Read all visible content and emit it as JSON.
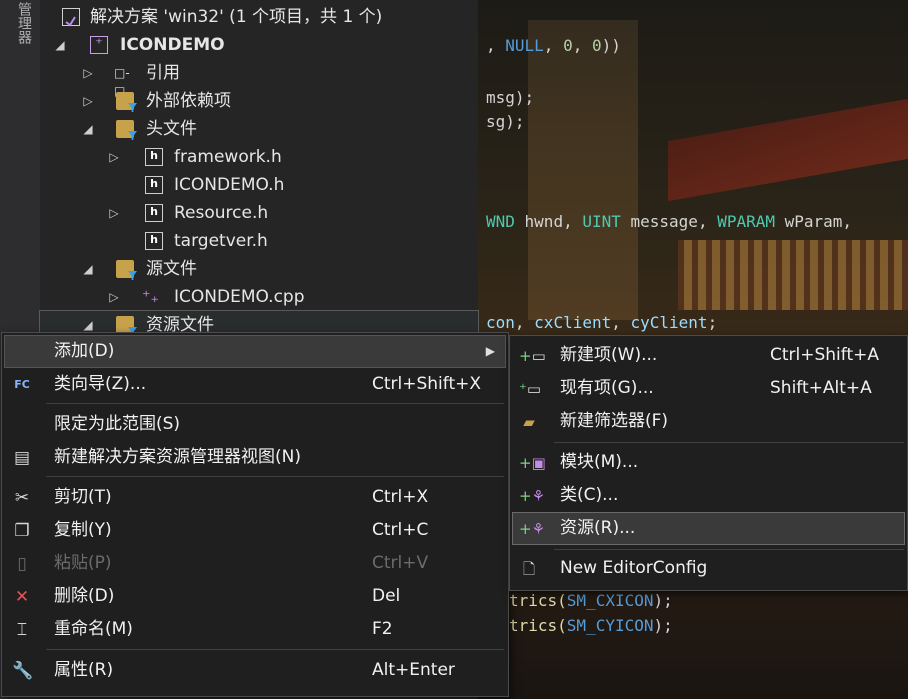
{
  "side_panel_label": "管理器",
  "tree": {
    "solution": "解决方案 'win32' (1 个项目，共 1 个)",
    "project": "ICONDEMO",
    "items": [
      {
        "label": "引用"
      },
      {
        "label": "外部依赖项"
      },
      {
        "label": "头文件"
      },
      {
        "label": "framework.h"
      },
      {
        "label": "ICONDEMO.h"
      },
      {
        "label": "Resource.h"
      },
      {
        "label": "targetver.h"
      },
      {
        "label": "源文件"
      },
      {
        "label": "ICONDEMO.cpp"
      },
      {
        "label": "资源文件"
      }
    ]
  },
  "code": {
    "line1": [
      ", ",
      "NULL",
      ", ",
      "0",
      ", ",
      "0",
      "))"
    ],
    "line2": "msg);",
    "line3": "sg);",
    "line4": [
      "WND",
      " hwnd, ",
      "UINT",
      " message, ",
      "WPARAM",
      " wParam,"
    ],
    "line5": [
      "con",
      ", ",
      "cxClient",
      ", ",
      "cyClient",
      ";"
    ],
    "line6": [
      "trics(",
      "SM_CXICON",
      ");"
    ],
    "line7": [
      "trics(",
      "SM_CYICON",
      ");"
    ]
  },
  "menu": {
    "items": [
      {
        "label": "添加(D)",
        "shortcut": ""
      },
      {
        "label": "类向导(Z)...",
        "shortcut": "Ctrl+Shift+X"
      },
      {
        "label": "限定为此范围(S)",
        "shortcut": ""
      },
      {
        "label": "新建解决方案资源管理器视图(N)",
        "shortcut": ""
      },
      {
        "label": "剪切(T)",
        "shortcut": "Ctrl+X"
      },
      {
        "label": "复制(Y)",
        "shortcut": "Ctrl+C"
      },
      {
        "label": "粘贴(P)",
        "shortcut": "Ctrl+V"
      },
      {
        "label": "删除(D)",
        "shortcut": "Del"
      },
      {
        "label": "重命名(M)",
        "shortcut": "F2"
      },
      {
        "label": "属性(R)",
        "shortcut": "Alt+Enter"
      }
    ]
  },
  "submenu": {
    "items": [
      {
        "label": "新建项(W)...",
        "shortcut": "Ctrl+Shift+A"
      },
      {
        "label": "现有项(G)...",
        "shortcut": "Shift+Alt+A"
      },
      {
        "label": "新建筛选器(F)",
        "shortcut": ""
      },
      {
        "label": "模块(M)...",
        "shortcut": ""
      },
      {
        "label": "类(C)...",
        "shortcut": ""
      },
      {
        "label": "资源(R)...",
        "shortcut": ""
      },
      {
        "label": "New EditorConfig",
        "shortcut": ""
      }
    ]
  },
  "colors": {
    "accent_plus": "#7fd47f",
    "keyword": "#4ec9b0",
    "macro": "#569cd6",
    "delete_icon": "#e05555"
  }
}
